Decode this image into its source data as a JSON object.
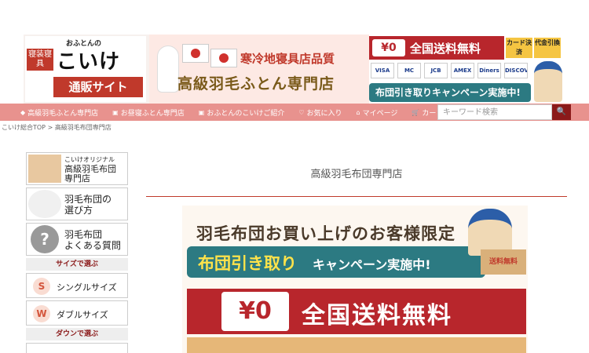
{
  "header": {
    "logo": {
      "small_text": "おふとんの",
      "side_text": "寝装寝具",
      "main_text": "こいけ",
      "sub_text": "通販サイト"
    },
    "banner": {
      "line1": "寒冷地寝具店品質",
      "line2": "高級羽毛ふとん専門店"
    },
    "promo": {
      "truck_label": "¥0",
      "shipping_text": "全国送料無料",
      "card_pay": "カード決済",
      "cod": "代金引換",
      "cards": [
        "VISA",
        "MC",
        "JCB",
        "AMEX",
        "Diners",
        "DISCOVER"
      ],
      "pickup_text": "布団引き取りキャンペーン実施中!"
    }
  },
  "nav": {
    "items": [
      {
        "icon": "◆",
        "label": "高級羽毛ふとん専門店"
      },
      {
        "icon": "▣",
        "label": "お昼寝ふとん専門店"
      },
      {
        "icon": "▣",
        "label": "おふとんのこいけご紹介"
      },
      {
        "icon": "♡",
        "label": "お気に入り"
      },
      {
        "icon": "⌂",
        "label": "マイページ"
      },
      {
        "icon": "🛒",
        "label": "カート"
      }
    ],
    "search_placeholder": "キーワード検索",
    "search_button_icon": "🔍"
  },
  "breadcrumb": {
    "home": "こいけ総合TOP",
    "separator": ">",
    "current": "高級羽毛布団専門店"
  },
  "sidebar": {
    "cards": [
      {
        "line1": "こいけオリジナル",
        "line2": "高級羽毛布団",
        "line3": "専門店"
      },
      {
        "line1": "羽毛布団の",
        "line2": "選び方"
      },
      {
        "thumb": "?",
        "line1": "羽毛布団",
        "line2": "よくある質問"
      }
    ],
    "size_heading": "サイズで選ぶ",
    "sizes": [
      {
        "letter": "S",
        "label": "シングルサイズ"
      },
      {
        "letter": "W",
        "label": "ダブルサイズ"
      }
    ],
    "down_heading": "ダウンで選ぶ"
  },
  "main": {
    "page_title": "高級羽毛布団専門店",
    "campaign": {
      "headline": "羽毛布団お買い上げのお客様限定",
      "pill_strong": "布団引き取り",
      "pill_rest": "キャンペーン実施中!",
      "box_label": "送料無料",
      "truck_label": "¥0",
      "free_text": "全国送料無料"
    }
  },
  "colors": {
    "nav_bg": "#e8928e",
    "accent_red": "#b8262c",
    "teal": "#2c7a82",
    "search_button": "#8b1a1a"
  }
}
